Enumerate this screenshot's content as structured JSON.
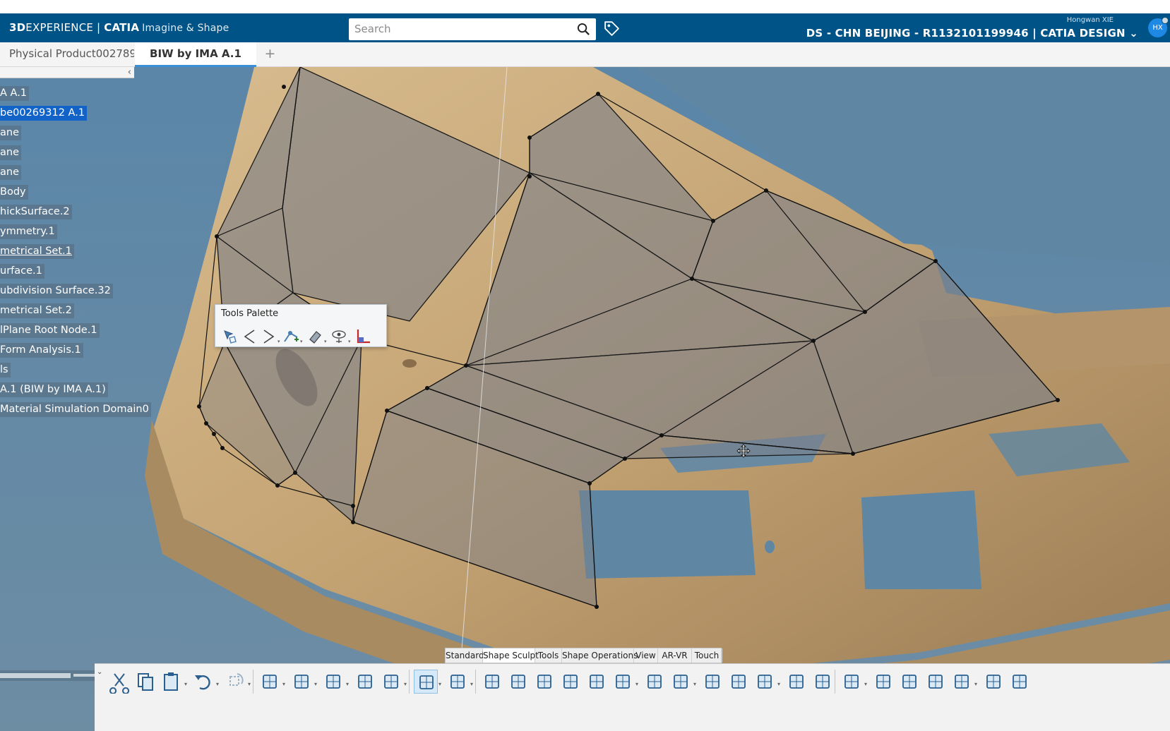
{
  "header": {
    "brand_bold": "3D",
    "brand_light": "EXPERIENCE | ",
    "brand_app": "CATIA",
    "brand_tagline": "Imagine & Shape",
    "search_placeholder": "Search",
    "user_name": "Hongwan XIE",
    "context": "DS - CHN BEIJING - R1132101199946 | CATIA DESIGN",
    "context_chevron": "⌄",
    "avatar_initials": "HX"
  },
  "tabs": [
    {
      "label": "Physical Product002789"
    },
    {
      "label": "BIW by IMA A.1"
    }
  ],
  "tab_add": "+",
  "tree": {
    "collapse_glyph": "‹",
    "items": [
      {
        "label": "A A.1",
        "selected": false,
        "underline": false
      },
      {
        "label": "be00269312 A.1",
        "selected": true,
        "underline": false
      },
      {
        "label": "ane",
        "selected": false,
        "underline": false
      },
      {
        "label": "ane",
        "selected": false,
        "underline": false
      },
      {
        "label": "ane",
        "selected": false,
        "underline": false
      },
      {
        "label": "Body",
        "selected": false,
        "underline": false
      },
      {
        "label": "hickSurface.2",
        "selected": false,
        "underline": false
      },
      {
        "label": "ymmetry.1",
        "selected": false,
        "underline": false
      },
      {
        "label": "metrical Set.1",
        "selected": false,
        "underline": true
      },
      {
        "label": "urface.1",
        "selected": false,
        "underline": false
      },
      {
        "label": "ubdivision Surface.32",
        "selected": false,
        "underline": false
      },
      {
        "label": "metrical Set.2",
        "selected": false,
        "underline": false
      },
      {
        "label": "lPlane Root Node.1",
        "selected": false,
        "underline": false
      },
      {
        "label": " Form Analysis.1",
        "selected": false,
        "underline": false
      },
      {
        "label": "ls",
        "selected": false,
        "underline": false
      },
      {
        "label": "A.1 (BIW by IMA A.1)",
        "selected": false,
        "underline": false
      },
      {
        "label": "Material Simulation Domain0",
        "selected": false,
        "underline": false
      }
    ]
  },
  "palette": {
    "title": "Tools Palette",
    "tools": [
      "select-icon",
      "previous-icon",
      "next-icon",
      "add-vertex-icon",
      "eraser-icon",
      "visibility-icon",
      "corner-icon"
    ]
  },
  "section_tabs": [
    {
      "label": "Standard",
      "active": false
    },
    {
      "label": "Shape Sculpt",
      "active": true
    },
    {
      "label": "Tools",
      "active": false
    },
    {
      "label": "Shape Operations",
      "active": false
    },
    {
      "label": "View",
      "active": false
    },
    {
      "label": "AR-VR",
      "active": false
    },
    {
      "label": "Touch",
      "active": false
    }
  ],
  "action_bar": {
    "collapse_glyph": "⌄",
    "items": [
      "cut-icon",
      "copy-icon",
      "paste-icon",
      "undo-icon",
      "redo-icon",
      "subdivision-icon",
      "plane-icon",
      "sphere-icon",
      "cube-icon",
      "curve-icon",
      "edit-icon",
      "sketch-icon",
      "vertex-icon",
      "points-icon",
      "weld-icon",
      "split-icon",
      "face-icon",
      "mirror-icon",
      "extrude-icon",
      "bridge-icon",
      "primitive-icon",
      "box-icon",
      "cylinder-icon",
      "open-box-icon",
      "wrap-icon",
      "lattice-icon",
      "align-icon",
      "project-icon",
      "surface-icon",
      "sweep-icon",
      "blend-icon",
      "wave-icon"
    ]
  },
  "colors": {
    "header": "#005386",
    "viewport": "#5f87a4",
    "model": "#c7a77a",
    "cage": "#8e9297",
    "selection": "#1263c8"
  }
}
